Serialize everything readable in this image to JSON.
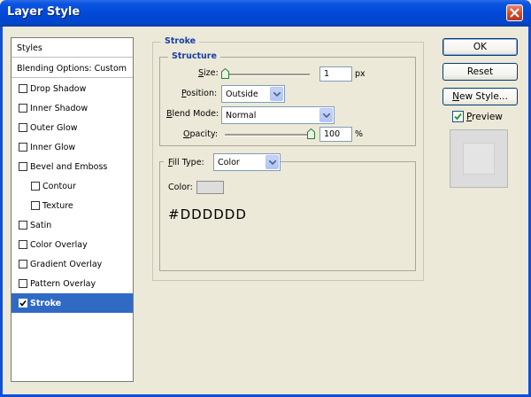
{
  "window": {
    "title": "Layer Style"
  },
  "styles_list": {
    "header": "Styles",
    "blending_options": "Blending Options: Custom",
    "items": [
      {
        "label": "Drop Shadow",
        "checked": false,
        "indent": false
      },
      {
        "label": "Inner Shadow",
        "checked": false,
        "indent": false
      },
      {
        "label": "Outer Glow",
        "checked": false,
        "indent": false
      },
      {
        "label": "Inner Glow",
        "checked": false,
        "indent": false
      },
      {
        "label": "Bevel and Emboss",
        "checked": false,
        "indent": false
      },
      {
        "label": "Contour",
        "checked": false,
        "indent": true
      },
      {
        "label": "Texture",
        "checked": false,
        "indent": true
      },
      {
        "label": "Satin",
        "checked": false,
        "indent": false
      },
      {
        "label": "Color Overlay",
        "checked": false,
        "indent": false
      },
      {
        "label": "Gradient Overlay",
        "checked": false,
        "indent": false
      },
      {
        "label": "Pattern Overlay",
        "checked": false,
        "indent": false
      },
      {
        "label": "Stroke",
        "checked": true,
        "indent": false,
        "selected": true
      }
    ]
  },
  "stroke": {
    "title": "Stroke",
    "structure": {
      "title": "Structure",
      "size": {
        "label_prefix": "S",
        "label_rest": "ize:",
        "value": "1",
        "unit": "px",
        "slider_fraction": 0.0
      },
      "position": {
        "label_prefix": "P",
        "label_rest": "osition:",
        "value": "Outside"
      },
      "blend_mode": {
        "label_prefix": "B",
        "label_rest": "lend Mode:",
        "value": "Normal"
      },
      "opacity": {
        "label_prefix": "O",
        "label_rest": "pacity:",
        "value": "100",
        "unit": "%",
        "slider_fraction": 1.0
      }
    },
    "fill": {
      "fill_type_label_prefix": "F",
      "fill_type_label_rest": "ill Type:",
      "fill_type_value": "Color",
      "color_label": "Color:",
      "color_hex": "#DDDDDD",
      "swatch_color": "#dddddd"
    }
  },
  "buttons": {
    "ok": "OK",
    "reset": "Reset",
    "new_style_prefix": "N",
    "new_style_rest": "ew Style...",
    "preview_prefix": "P",
    "preview_rest": "review",
    "preview_checked": true
  },
  "colors": {
    "title_bar": "#0248d8",
    "selection": "#316ac5",
    "group_title": "#1a40a6",
    "close_button": "#d24a2a"
  }
}
